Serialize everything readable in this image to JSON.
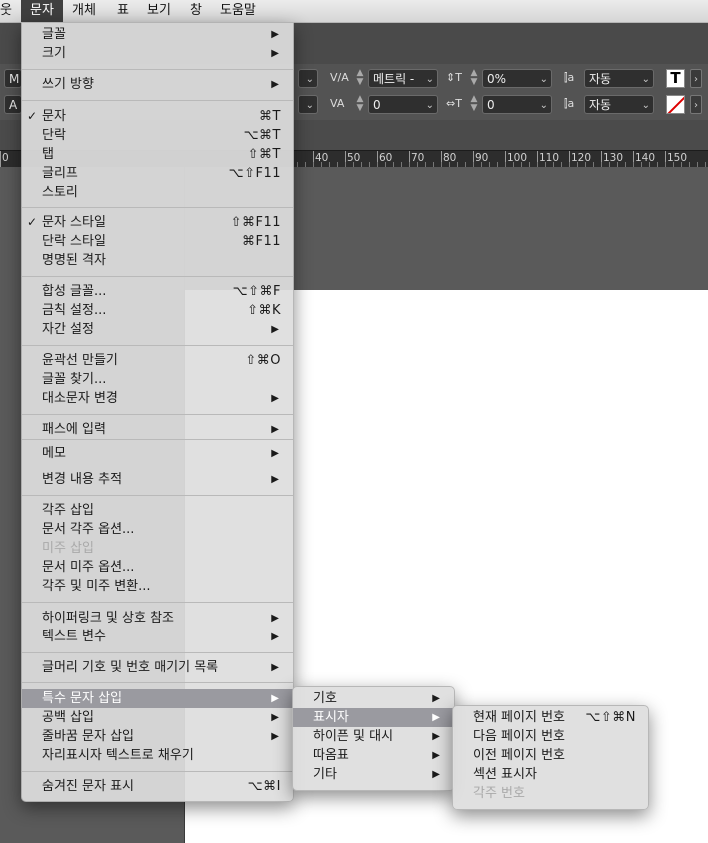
{
  "menubar": {
    "items": [
      "웃",
      "문자",
      "개체",
      "표",
      "보기",
      "창",
      "도움말"
    ],
    "active": "문자"
  },
  "control_panel": {
    "row1": {
      "left_field": "M",
      "kerning_value": "메트릭 -",
      "tracking_value": "0%",
      "vscale_value": "자동"
    },
    "row2": {
      "left_field": "A",
      "kerning2_value": "0",
      "tracking2_value": "0",
      "hscale_value": "자동"
    }
  },
  "ruler": {
    "labels": [
      "0",
      "40",
      "50",
      "60",
      "70",
      "80",
      "90",
      "100",
      "110",
      "120",
      "130",
      "140",
      "150"
    ]
  },
  "main_menu": {
    "items": [
      {
        "label": "글꼴",
        "arrow": true
      },
      {
        "label": "크기",
        "arrow": true
      },
      {
        "label": "쓰기 방향",
        "arrow": true
      },
      {
        "label": "문자",
        "check": true,
        "shortcut": "⌘T"
      },
      {
        "label": "단락",
        "shortcut": "⌥⌘T"
      },
      {
        "label": "탭",
        "shortcut": "⇧⌘T"
      },
      {
        "label": "글리프",
        "shortcut": "⌥⇧F11"
      },
      {
        "label": "스토리"
      },
      {
        "label": "문자 스타일",
        "check": true,
        "shortcut": "⇧⌘F11"
      },
      {
        "label": "단락 스타일",
        "shortcut": "⌘F11"
      },
      {
        "label": "명명된 격자"
      },
      {
        "label": "합성 글꼴...",
        "shortcut": "⌥⇧⌘F"
      },
      {
        "label": "금칙 설정...",
        "shortcut": "⇧⌘K"
      },
      {
        "label": "자간 설정",
        "arrow": true
      },
      {
        "label": "윤곽선 만들기",
        "shortcut": "⇧⌘O"
      },
      {
        "label": "글꼴 찾기..."
      },
      {
        "label": "대소문자 변경",
        "arrow": true
      },
      {
        "label": "패스에 입력",
        "arrow": true
      },
      {
        "label": "메모",
        "arrow": true
      },
      {
        "label": "변경 내용 추적",
        "arrow": true
      },
      {
        "label": "각주 삽입"
      },
      {
        "label": "문서 각주 옵션..."
      },
      {
        "label": "미주 삽입",
        "disabled": true
      },
      {
        "label": "문서 미주 옵션..."
      },
      {
        "label": "각주 및 미주 변환..."
      },
      {
        "label": "하이퍼링크 및 상호 참조",
        "arrow": true
      },
      {
        "label": "텍스트 변수",
        "arrow": true
      },
      {
        "label": "글머리 기호 및 번호 매기기 목록",
        "arrow": true
      },
      {
        "label": "특수 문자 삽입",
        "arrow": true,
        "highlighted": true
      },
      {
        "label": "공백 삽입",
        "arrow": true
      },
      {
        "label": "줄바꿈 문자 삽입",
        "arrow": true
      },
      {
        "label": "자리표시자 텍스트로 채우기"
      },
      {
        "label": "숨겨진 문자 표시",
        "shortcut": "⌥⌘I"
      }
    ]
  },
  "submenu_special": {
    "items": [
      {
        "label": "기호",
        "arrow": true
      },
      {
        "label": "표시자",
        "arrow": true,
        "highlighted": true
      },
      {
        "label": "하이픈 및 대시",
        "arrow": true
      },
      {
        "label": "따옴표",
        "arrow": true
      },
      {
        "label": "기타",
        "arrow": true
      }
    ]
  },
  "submenu_markers": {
    "items": [
      {
        "label": "현재 페이지 번호",
        "shortcut": "⌥⇧⌘N"
      },
      {
        "label": "다음 페이지 번호"
      },
      {
        "label": "이전 페이지 번호"
      },
      {
        "label": "섹션 표시자"
      },
      {
        "label": "각주 번호",
        "disabled": true
      }
    ]
  },
  "colors": {
    "menu_bg": "#dedede",
    "highlight": "#9a9aa0",
    "app_bg": "#535353",
    "page": "#ffffff"
  }
}
